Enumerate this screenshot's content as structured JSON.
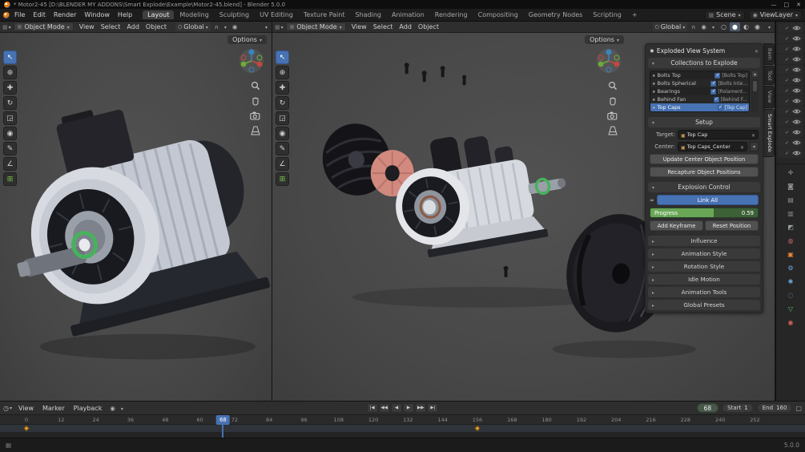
{
  "colors": {
    "accent_blue": "#4772b3",
    "progress_green": "#69a756",
    "keyframe_orange": "#f0a431",
    "viewport_bg": "#474747",
    "panel_bg": "#2d2d2d"
  },
  "titlebar": {
    "title": "* Motor2-45 [D:\\BLENDER MY ADDONS\\Smart Explode\\Example\\Motor2-45.blend] - Blender 5.0.0",
    "window_controls": [
      {
        "glyph": "—",
        "name": "minimize-button"
      },
      {
        "glyph": "□",
        "name": "maximize-button"
      },
      {
        "glyph": "✕",
        "name": "close-button"
      }
    ]
  },
  "menubar": {
    "menus": [
      {
        "label": "File"
      },
      {
        "label": "Edit"
      },
      {
        "label": "Render"
      },
      {
        "label": "Window"
      },
      {
        "label": "Help"
      }
    ],
    "workspaces": [
      {
        "label": "Layout",
        "active": true
      },
      {
        "label": "Modeling"
      },
      {
        "label": "Sculpting"
      },
      {
        "label": "UV Editing"
      },
      {
        "label": "Texture Paint"
      },
      {
        "label": "Shading"
      },
      {
        "label": "Animation"
      },
      {
        "label": "Rendering"
      },
      {
        "label": "Compositing"
      },
      {
        "label": "Geometry Nodes"
      },
      {
        "label": "Scripting"
      },
      {
        "label": "+"
      }
    ],
    "scene": "Scene",
    "viewlayer": "ViewLayer"
  },
  "viewport_header": {
    "mode": "Object Mode",
    "menus": [
      {
        "label": "View"
      },
      {
        "label": "Select"
      },
      {
        "label": "Add"
      },
      {
        "label": "Object"
      }
    ],
    "orientation": "Global",
    "options_label": "Options"
  },
  "tools": [
    {
      "glyph": "↖",
      "name": "select-box-tool",
      "active": true
    },
    {
      "glyph": "⊕",
      "name": "cursor-tool"
    },
    {
      "glyph": "✚",
      "name": "move-tool"
    },
    {
      "glyph": "↻",
      "name": "rotate-tool"
    },
    {
      "glyph": "◲",
      "name": "scale-tool"
    },
    {
      "glyph": "◉",
      "name": "transform-tool"
    },
    {
      "glyph": "✎",
      "name": "annotate-tool"
    },
    {
      "glyph": "∠",
      "name": "measure-tool"
    },
    {
      "glyph": "⊞",
      "name": "add-cube-tool",
      "color": "#7bc24a"
    }
  ],
  "panel": {
    "title": "Exploded View System",
    "collections": {
      "title": "Collections to Explode",
      "items": [
        {
          "name": "Bolts Top",
          "collection": "[Bolts Top]",
          "checked": true
        },
        {
          "name": "Bolts Spherical",
          "collection": "[Bolts Inte...",
          "checked": true
        },
        {
          "name": "Bearings",
          "collection": "[Rolament...",
          "checked": true
        },
        {
          "name": "Behind Fan",
          "collection": "[Behind F...",
          "checked": true
        },
        {
          "name": "Top Caps",
          "collection": "[Top Cap]",
          "checked": true,
          "selected": true
        }
      ]
    },
    "setup": {
      "title": "Setup",
      "target_label": "Target:",
      "target_value": "Top Cap",
      "center_label": "Center:",
      "center_value": "Top Caps_Center",
      "update_button": "Update Center Object Position",
      "recapture_button": "Recapture Object Positions"
    },
    "explosion": {
      "title": "Explosion Control",
      "link_all": "Link All",
      "progress_label": "Progress",
      "progress_value": "0.59",
      "progress_pct": 59,
      "add_keyframe": "Add Keyframe",
      "reset_position": "Reset Position"
    },
    "collapsed_sections": [
      "Influence",
      "Animation Style",
      "Rotation Style",
      "Idle Motion",
      "Animation Tools",
      "Global Presets"
    ]
  },
  "sidebar_tabs": [
    {
      "label": "Item"
    },
    {
      "label": "Tool"
    },
    {
      "label": "View"
    },
    {
      "label": "Smart Explode",
      "active": true
    }
  ],
  "outliner": {
    "rows": [
      {},
      {},
      {},
      {},
      {},
      {},
      {},
      {},
      {},
      {},
      {},
      {},
      {}
    ]
  },
  "properties_tabs": [
    {
      "glyph": "✛",
      "color": "#9aa0a6",
      "name": "tool-tab"
    },
    {
      "glyph": "◙",
      "color": "#8f8f94",
      "name": "render-tab"
    },
    {
      "glyph": "▤",
      "color": "#8f8f94",
      "name": "output-tab"
    },
    {
      "glyph": "▥",
      "color": "#8f8f94",
      "name": "view-layer-tab"
    },
    {
      "glyph": "◩",
      "color": "#9aa0a6",
      "name": "scene-tab"
    },
    {
      "glyph": "◍",
      "color": "#bf6a6a",
      "name": "world-tab"
    },
    {
      "glyph": "▣",
      "color": "#e8883a",
      "name": "object-tab"
    },
    {
      "glyph": "⚙",
      "color": "#6fa8dc",
      "name": "modifiers-tab"
    },
    {
      "glyph": "✱",
      "color": "#6fa8dc",
      "name": "particles-tab"
    },
    {
      "glyph": "◌",
      "color": "#6fa8dc",
      "name": "physics-tab"
    },
    {
      "glyph": "▽",
      "color": "#5fbf77",
      "name": "object-data-tab"
    },
    {
      "glyph": "◉",
      "color": "#d9605a",
      "name": "material-tab"
    }
  ],
  "timeline": {
    "menus": [
      {
        "label": "View"
      },
      {
        "label": "Marker"
      },
      {
        "label": "Playback"
      }
    ],
    "transport": [
      {
        "glyph": "|◀",
        "name": "jump-to-start-button"
      },
      {
        "glyph": "◀◀",
        "name": "prev-keyframe-button"
      },
      {
        "glyph": "◀",
        "name": "play-reverse-button"
      },
      {
        "glyph": "▶",
        "name": "play-button"
      },
      {
        "glyph": "▶▶",
        "name": "next-keyframe-button"
      },
      {
        "glyph": "▶|",
        "name": "jump-to-end-button"
      }
    ],
    "current_frame": 68,
    "start_label": "Start",
    "start": 1,
    "end_label": "End",
    "end": 160,
    "ticks": [
      0,
      12,
      24,
      36,
      48,
      60,
      72,
      84,
      96,
      108,
      120,
      132,
      144,
      156,
      168,
      180,
      192,
      204,
      216,
      228,
      240,
      252
    ],
    "keyframes": [
      0,
      156
    ]
  },
  "statusbar": {
    "version": "5.0.0"
  }
}
